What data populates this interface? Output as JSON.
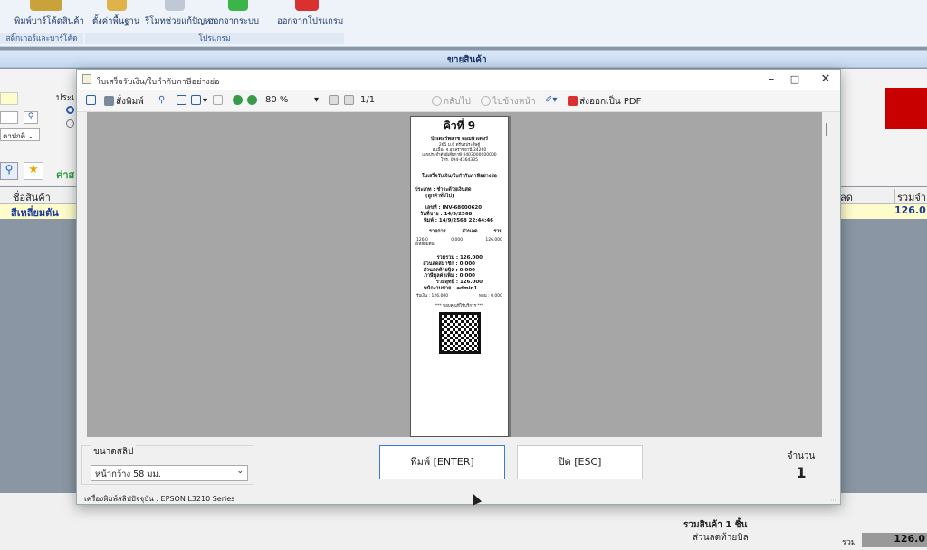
{
  "ribbon": {
    "group1": {
      "button": "พิมพ์บาร์โค้ดสินค้า",
      "caption": "สติ๊กเกอร์และบาร์โค้ด"
    },
    "group2": {
      "buttons": [
        "ตั้งค่าพื้นฐาน",
        "รีโมทช่วยแก้ปัญหา",
        "ออกจากระบบ",
        "ออกจากโปรแกรม"
      ],
      "caption": "โปรแกรม"
    }
  },
  "sales_tab": "ขายสินค้า",
  "background": {
    "left_label": "ประเ",
    "dropdown_text": "คาปกติ",
    "search_label": "ค่าส",
    "grid": {
      "col_product": "ชื่อสินค้า",
      "col_discount": "ลด",
      "col_total": "รวมจำ",
      "row_product": "สีเหลี่ยมตัน",
      "row_total": "126.0"
    },
    "summary": {
      "items": "รวมสินค้า 1 ชิ้น",
      "bill_discount": "ส่วนลดท้ายบิล",
      "total_label": "รวม",
      "total_value": "126.0"
    }
  },
  "dialog": {
    "title": "ใบเสร็จรับเงิน/ใบกำกับภาษีอย่างย่อ",
    "toolbar": {
      "print": "สั่งพิมพ์",
      "zoom": "80 %",
      "page": "1/1",
      "back": "กลับไป",
      "forward": "ไปข้างหน้า",
      "pdf": "ส่งออกเป็น PDF"
    },
    "receipt": {
      "queue": "คิวที่ 9",
      "shop": "ปักเตอร์พลาซ คอมพิวเตอร์",
      "addr1": "265 ม.6 ตรีนงประสิษฐ์",
      "addr2": "อ.เมือง จ.อุบลราชธานี 34260",
      "addr3": "เลขประจำตัวผู้เสียภาษี 0403000000000",
      "addr4": "โทร. 094-4364335",
      "doc_title": "ใบเสร็จรับเงิน/ใบกำกับภาษีอย่างย่อ",
      "type1": "ประเภท : ชำระด้วยเงินสด",
      "type2": "(ลูกค้าทั่วไป)",
      "inv": "เลขที่ : INV-68000620",
      "date": "วันที่ขาย : 14/9/2568",
      "printed": "พิมพ์ : 14/9/2568 22:44:46",
      "h_items": "รายการ",
      "h_disc": "ส่วนลด",
      "h_total": "รวม",
      "item_qty": "126.0",
      "item_name": "สี่เหลี่ยมตัน",
      "item_disc": "0.000",
      "item_total": "126.000",
      "subtotal": "รวมรวม : 126.000",
      "disc1": "ส่วนลดสมาชิก : 0.000",
      "disc2": "ส่วนลดท้ายบิล : 0.000",
      "vat": "ภาษีมูลค่าเพิ่ม : 0.000",
      "net": "รวมสุทธิ : 126.000",
      "cashier": "พนักงานขาย : admin1",
      "paid": "รับเงิน : 126.000",
      "change": "ทอน : 0.000",
      "thanks": "*** ขอบคุณที่ใช้บริการ ***"
    },
    "footer": {
      "size_label": "ขนาดสลิป",
      "size_value": "หน้ากว้าง 58 มม.",
      "print_btn": "พิมพ์ [ENTER]",
      "close_btn": "ปิด [ESC]",
      "count_label": "จำนวน",
      "count_value": "1",
      "status": "เครื่องพิมพ์สลิปปัจจุบัน : EPSON L3210 Series"
    }
  }
}
